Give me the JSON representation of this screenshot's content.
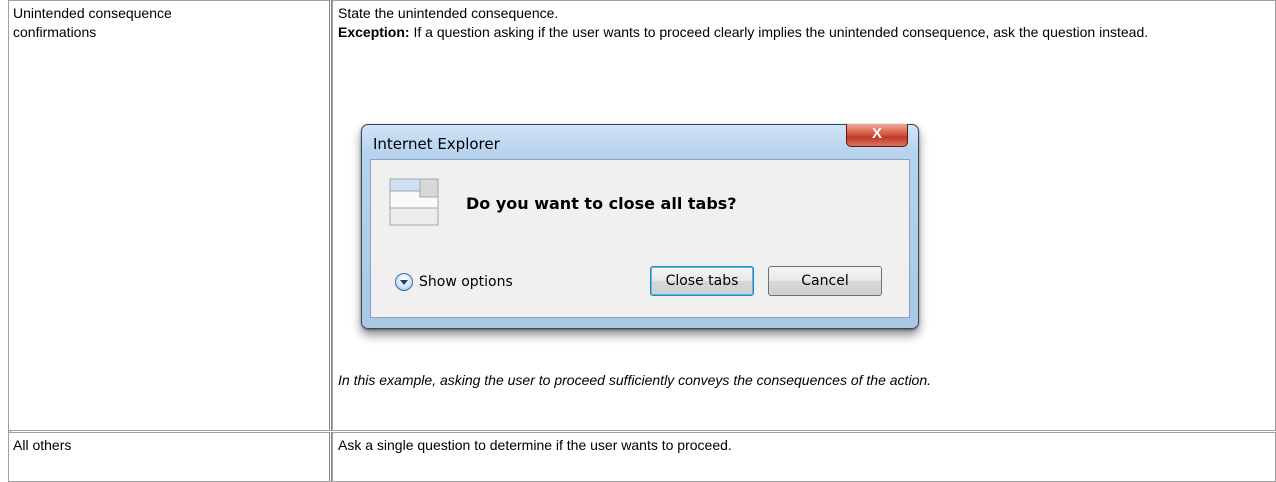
{
  "rows": [
    {
      "label": "Unintended consequence confirmations",
      "content": {
        "line1": "State the unintended consequence.",
        "exception_label": "Exception:",
        "exception_text": " If a question asking if the user wants to proceed clearly implies the unintended consequence, ask the question instead.",
        "caption": "In this example, asking the user to proceed sufficiently conveys the consequences of the action."
      }
    },
    {
      "label": "All others",
      "content": {
        "line1": "Ask a single question to determine if the user wants to proceed."
      }
    }
  ],
  "dialog": {
    "title": "Internet Explorer",
    "close_glyph": "X",
    "question": "Do you want to close all tabs?",
    "show_options": "Show options",
    "primary_button": "Close tabs",
    "secondary_button": "Cancel",
    "icon": "tabs-window-icon",
    "accent_color": "#c0392b"
  }
}
